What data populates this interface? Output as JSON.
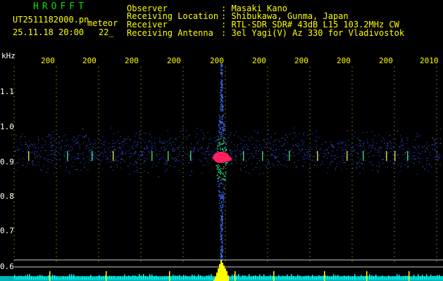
{
  "header": {
    "app_title": "HROFFT",
    "file_name": "UT2511182000.pn",
    "file_tag": "meteor",
    "date_time": "25.11.18 20:00",
    "count": "22_",
    "fields": [
      {
        "label": "Observer",
        "value": ": Masaki Kano"
      },
      {
        "label": "Receiving Location",
        "value": ": Shibukawa, Gunma, Japan"
      },
      {
        "label": "Receiver",
        "value": ": RTL-SDR SDR# 43dB L15 103.2MHz CW"
      },
      {
        "label": "Receiving Antenna",
        "value": ": 3el Yagi(V) Az 330 for Vladivostok"
      }
    ]
  },
  "plot": {
    "y_unit": "kHz",
    "x_ticks": [
      "200",
      "200",
      "200",
      "200",
      "200",
      "200",
      "200",
      "200",
      "200",
      "2010"
    ],
    "y_ticks": [
      "1.1",
      "1.0",
      "0.9",
      "0.8",
      "0.7",
      "0.6"
    ],
    "colors": {
      "grid": "#ffff00",
      "signal": "#ffff00",
      "noise": "#3050ff",
      "hot": "#ff2060",
      "baseline": "#00ffff"
    }
  }
}
